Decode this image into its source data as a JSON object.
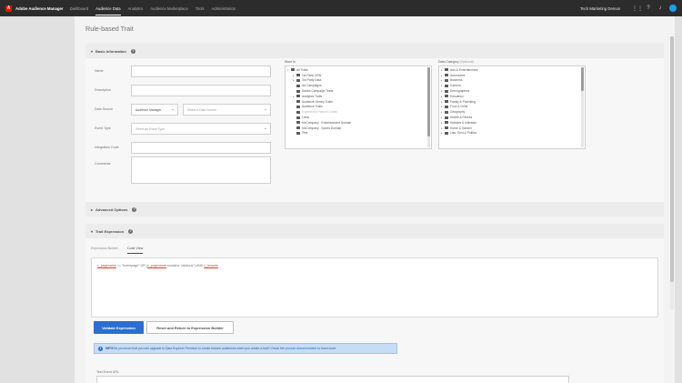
{
  "app": {
    "logo_letter": "A",
    "name": "Adobe Audience Manager",
    "nav": [
      "Dashboard",
      "Audience Data",
      "Analytics",
      "Audience Marketplace",
      "Tools",
      "Administration"
    ],
    "org": "Tech Marketing Demos",
    "icons": [
      "grid-icon",
      "help-icon",
      "notification-icon",
      "user-avatar"
    ]
  },
  "page": {
    "title": "Rule-based Trait"
  },
  "basic": {
    "heading": "Basic Information",
    "labels": {
      "name": "Name",
      "description": "Description",
      "data_source": "Data Source",
      "event_type": "Event Type",
      "integration_code": "Integration Code",
      "comments": "Comments"
    },
    "data_source_value": "Audience Manager",
    "data_source_placeholder": "Select a Data Source",
    "event_type_placeholder": "Select an Event Type",
    "store_in": {
      "label": "Store In",
      "items": [
        {
          "text": "All Traits",
          "toggle": "▾",
          "grey": false
        },
        {
          "text": "1st Party CRM",
          "toggle": "▸",
          "grey": false
        },
        {
          "text": "3rd Party Data",
          "toggle": "▸",
          "grey": false
        },
        {
          "text": "Ad Campaigns",
          "toggle": "",
          "grey": false
        },
        {
          "text": "Adobe Campaign Traits",
          "toggle": "",
          "grey": false
        },
        {
          "text": "Analytics Traits",
          "toggle": "▸",
          "grey": false
        },
        {
          "text": "Audience Library Traits",
          "toggle": "",
          "grey": false
        },
        {
          "text": "Audience Traits",
          "toggle": "",
          "grey": false
        },
        {
          "text": "Experience Platform Traits",
          "toggle": "",
          "grey": true
        },
        {
          "text": "Lotus",
          "toggle": "",
          "grey": false
        },
        {
          "text": "McCompany - Entertainment Domain",
          "toggle": "",
          "grey": false
        },
        {
          "text": "McCompany - Sports Domain",
          "toggle": "",
          "grey": false
        },
        {
          "text": "Test",
          "toggle": "",
          "grey": false
        }
      ]
    },
    "data_category": {
      "label": "Data Category",
      "label_suffix": "(Optional)",
      "items": [
        {
          "text": "Arts & Entertainment",
          "toggle": "▸"
        },
        {
          "text": "Automotive",
          "toggle": "▸"
        },
        {
          "text": "Business",
          "toggle": "▸"
        },
        {
          "text": "Careers",
          "toggle": "▸"
        },
        {
          "text": "Demographics",
          "toggle": "▸"
        },
        {
          "text": "Education",
          "toggle": "▸"
        },
        {
          "text": "Family & Parenting",
          "toggle": "▸"
        },
        {
          "text": "Food & Drink",
          "toggle": "▸"
        },
        {
          "text": "Geography",
          "toggle": "▸"
        },
        {
          "text": "Health & Fitness",
          "toggle": "▸"
        },
        {
          "text": "Hobbies & Interests",
          "toggle": "▸"
        },
        {
          "text": "Home & Garden",
          "toggle": "▸"
        },
        {
          "text": "Law, Govt & Politics",
          "toggle": "▸"
        }
      ]
    }
  },
  "advanced": {
    "heading": "Advanced Options"
  },
  "expression": {
    "heading": "Trait Expression",
    "tabs": [
      "Expression Builder",
      "Code View"
    ],
    "code": {
      "v1": "c_pagename",
      "t1": " == \"homepage\" OR (",
      "v2": "c_pagename",
      "t2": " contains \"darkous\") AND ",
      "v3": "c_tenants"
    },
    "validate_label": "Validate Expression",
    "reset_label": "Reset and Return to Expression Builder",
    "info": {
      "icon": "i",
      "bold": "INFO",
      "text": " Did you know that you can upgrade to Data Explorer Premium to create historic audiences when you create a trait? Check the ",
      "link": "product documentation",
      "end": " to learn more."
    },
    "test_label": "Test Event URL"
  }
}
